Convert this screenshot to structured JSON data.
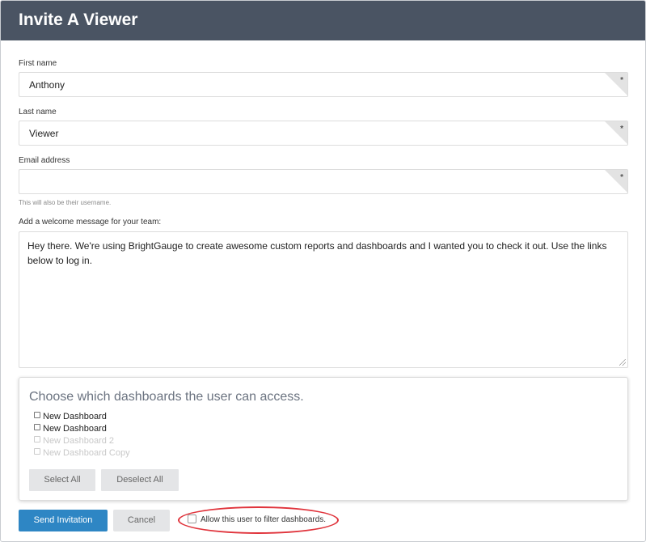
{
  "dialog": {
    "title": "Invite A Viewer"
  },
  "form": {
    "first_name": {
      "label": "First name",
      "value": "Anthony",
      "required_mark": "*"
    },
    "last_name": {
      "label": "Last name",
      "value": "Viewer",
      "required_mark": "*"
    },
    "email": {
      "label": "Email address",
      "value": "",
      "required_mark": "*",
      "hint": "This will also be their username."
    },
    "welcome": {
      "label": "Add a welcome message for your team:",
      "value": "Hey there. We're using BrightGauge to create awesome custom reports and dashboards and I wanted you to check it out. Use the links below to log in."
    }
  },
  "dashboards": {
    "title": "Choose which dashboards the user can access.",
    "items": [
      {
        "label": "New Dashboard",
        "checked": false,
        "disabled": false
      },
      {
        "label": "New Dashboard",
        "checked": false,
        "disabled": false
      },
      {
        "label": "New Dashboard 2",
        "checked": false,
        "disabled": true
      },
      {
        "label": "New Dashboard Copy",
        "checked": false,
        "disabled": true
      }
    ],
    "select_all_label": "Select All",
    "deselect_all_label": "Deselect All"
  },
  "footer": {
    "send_label": "Send Invitation",
    "cancel_label": "Cancel",
    "filter_label": "Allow this user to filter dashboards.",
    "filter_checked": false
  },
  "colors": {
    "header_bg": "#4a5463",
    "primary": "#2e86c4",
    "highlight": "#e0343c"
  }
}
